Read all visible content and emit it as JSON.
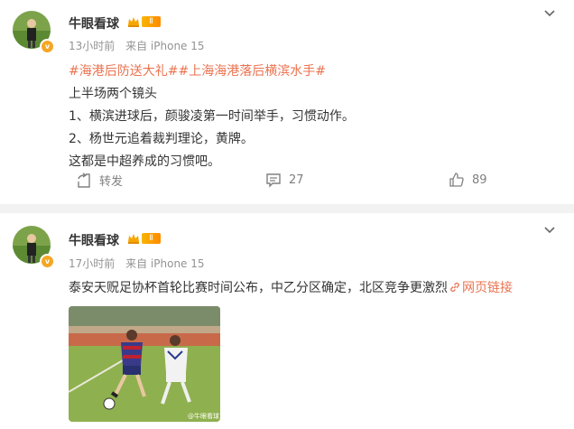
{
  "posts": [
    {
      "author": "牛眼看球",
      "level": "Ⅱ",
      "time": "13小时前",
      "source": "来自 iPhone 15",
      "hashtags": [
        "#海港后防送大礼#",
        "#上海海港落后横滨水手#"
      ],
      "lines": [
        "上半场两个镜头",
        "1、横滨进球后，颜骏凌第一时间举手，习惯动作。",
        "2、杨世元追着裁判理论，黄牌。",
        "这都是中超养成的习惯吧。"
      ],
      "repost_label": "转发",
      "comments": "27",
      "likes": "89"
    },
    {
      "author": "牛眼看球",
      "level": "Ⅱ",
      "time": "17小时前",
      "source": "来自 iPhone 15",
      "text": "泰安天贶足协杯首轮比赛时间公布，中乙分区确定，北区竞争更激烈",
      "link_label": "网页链接",
      "photo_watermark": "@牛眼看球"
    }
  ],
  "colors": {
    "accent": "#eb7350",
    "meta": "#939393",
    "badge": "#f5a623"
  }
}
